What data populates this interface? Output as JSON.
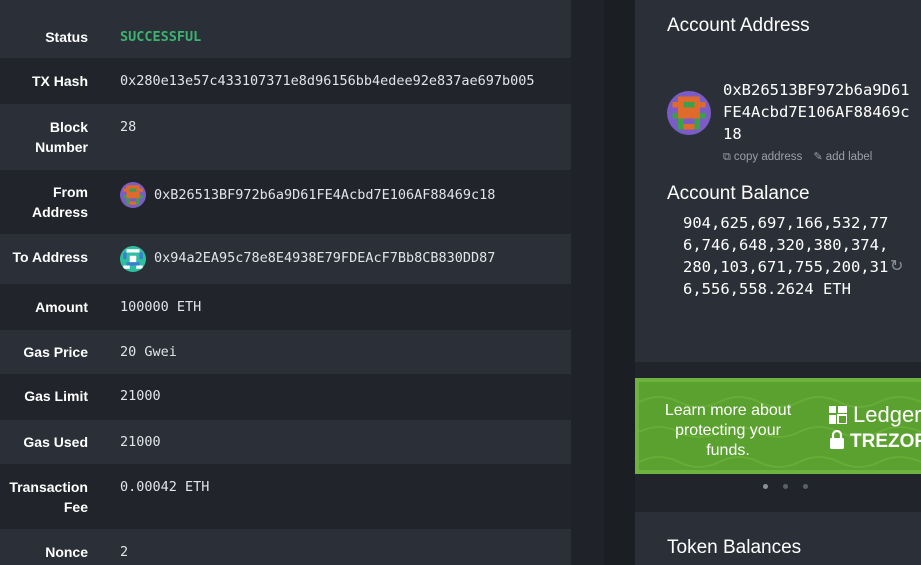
{
  "transaction": {
    "status_label": "Status",
    "status_value": "SUCCESSFUL",
    "tx_hash_label": "TX Hash",
    "tx_hash_value": "0x280e13e57c433107371e8d96156bb4edee92e837ae697b005",
    "block_number_label": "Block Number",
    "block_number_value": "28",
    "from_label": "From Address",
    "from_value": "0xB26513BF972b6a9D61FE4Acbd7E106AF88469c18",
    "to_label": "To Address",
    "to_value": "0x94a2EA95c78e8E4938E79FDEAcF7Bb8CB830DD87",
    "amount_label": "Amount",
    "amount_value": "100000 ETH",
    "gas_price_label": "Gas Price",
    "gas_price_value": "20 Gwei",
    "gas_limit_label": "Gas Limit",
    "gas_limit_value": "21000",
    "gas_used_label": "Gas Used",
    "gas_used_value": "21000",
    "tx_fee_label": "Transaction Fee",
    "tx_fee_value": "0.00042 ETH",
    "nonce_label": "Nonce",
    "nonce_value": "2"
  },
  "account": {
    "title": "Account Address",
    "address": "0xB26513BF972b6a9D61FE4Acbd7E106AF88469c18",
    "copy_label": "copy address",
    "add_label": "add label",
    "balance_title": "Account Balance",
    "balance_value": "904,625,697,166,532,776,746,648,320,380,374,280,103,671,755,200,316,556,558.2624 ETH"
  },
  "promo": {
    "text": "Learn more about protecting your funds.",
    "ledger": "Ledger",
    "trezor": "TREZOR"
  },
  "tokens": {
    "title": "Token Balances"
  },
  "colors": {
    "success": "#3cb371",
    "promo_green": "#6cb33f",
    "panel": "#2b2f37",
    "background": "#21252b"
  },
  "icons": {
    "copy": "copy-icon",
    "edit": "pencil-icon",
    "refresh": "refresh-icon",
    "ledger": "ledger-logo-icon",
    "trezor": "trezor-lock-icon"
  }
}
